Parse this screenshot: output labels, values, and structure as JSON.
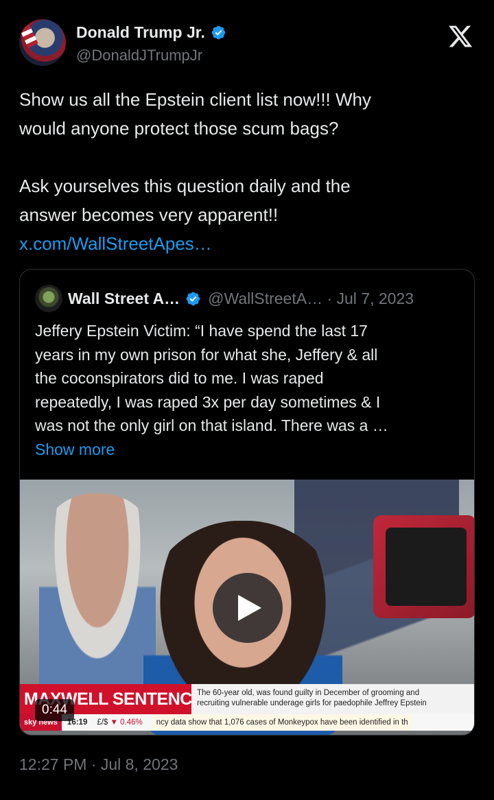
{
  "author": {
    "display_name": "Donald Trump Jr.",
    "handle": "@DonaldJTrumpJr"
  },
  "tweet": {
    "paragraph1": "Show us all the Epstein client list now!!! Why\nwould anyone protect those scum bags?",
    "paragraph2": "Ask yourselves this question daily and the\nanswer becomes very apparent!!",
    "link": "x.com/WallStreetApes…"
  },
  "quote": {
    "name": "Wall Street A…",
    "handle_date": "@WallStreetA… · Jul 7, 2023",
    "text": "Jeffery Epstein Victim: “I have spend the last 17\nyears in my own prison for what she, Jeffery & all\nthe coconspirators did to me. I was raped\nrepeatedly, I was raped 3x per day sometimes & I\nwas not the only girl on that island. There was a …",
    "show_more": "Show more",
    "video": {
      "duration": "0:44",
      "banner_headline": "MAXWELL SENTENCING",
      "banner_line1": "The 60-year old, was found guilty in December of grooming and",
      "banner_line2": "recruiting vulnerable underage girls for paedophile Jeffrey Epstein",
      "ticker_logo": "sky news",
      "ticker_time": "16:19",
      "ticker_fx_label": "£/$",
      "ticker_fx_value": "▼ 0.46%",
      "ticker_news": "ncy data show that 1,076 cases of Monkeypox have been identified in th"
    }
  },
  "timestamp": "12:27 PM · Jul 8, 2023",
  "colors": {
    "background": "#000000",
    "text": "#e7e9ea",
    "secondary": "#71767b",
    "link": "#1d9bf0",
    "verified": "#1d9bf0",
    "border": "#2f3336",
    "news_red": "#d0112b"
  },
  "icons": {
    "verified": "verified-badge-icon",
    "x_logo": "x-logo-icon",
    "play": "play-icon"
  }
}
